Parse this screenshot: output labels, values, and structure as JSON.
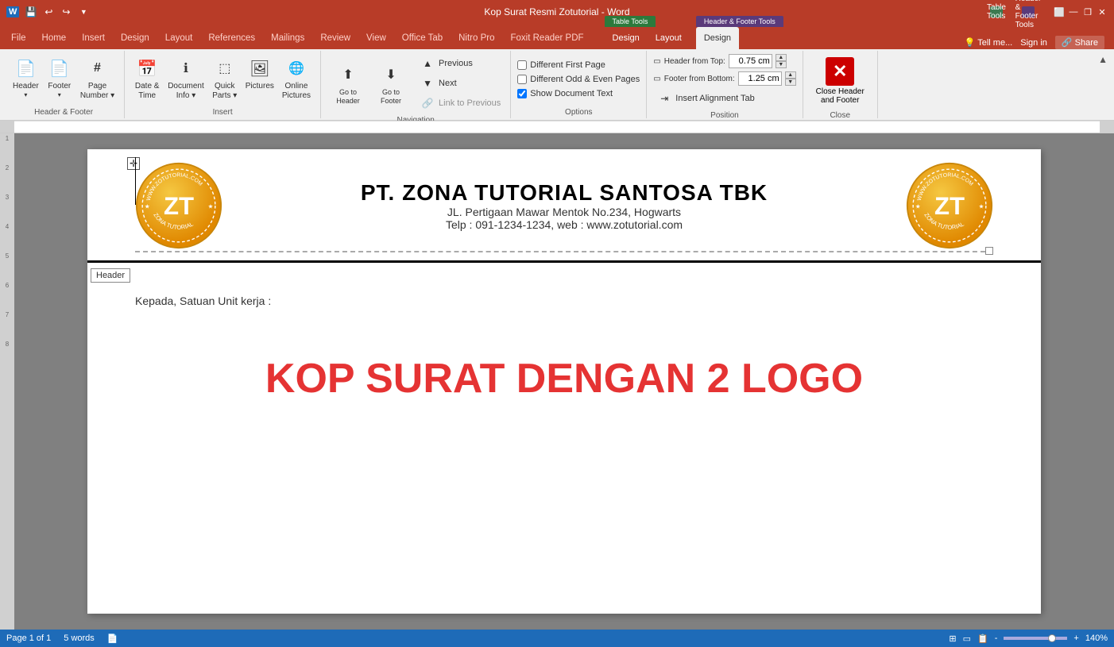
{
  "titlebar": {
    "title": "Kop Surat Resmi Zotutorial - Word",
    "controls": [
      "minimize",
      "restore",
      "close"
    ]
  },
  "quickaccess": {
    "buttons": [
      "save",
      "undo",
      "redo",
      "customize"
    ]
  },
  "ribbon_tabs": {
    "main": [
      "File",
      "Home",
      "Insert",
      "Design",
      "Layout",
      "References",
      "Mailings",
      "Review",
      "View",
      "Office Tab",
      "Nitro Pro",
      "Foxit Reader PDF"
    ],
    "context_groups": [
      {
        "label": "Table Tools",
        "tabs": [
          "Design",
          "Layout"
        ]
      },
      {
        "label": "Header & Footer Tools",
        "tabs": [
          "Design"
        ]
      }
    ],
    "active_tab": "Design",
    "right_buttons": [
      "Tell me...",
      "Sign in",
      "Share"
    ]
  },
  "ribbon": {
    "sections": [
      {
        "label": "Header & Footer",
        "items": [
          {
            "id": "header-btn",
            "icon": "📄",
            "label": "Header\n▾"
          },
          {
            "id": "footer-btn",
            "icon": "📄",
            "label": "Footer\n▾"
          },
          {
            "id": "page-number-btn",
            "icon": "#",
            "label": "Page\nNumber ▾"
          }
        ]
      },
      {
        "label": "Insert",
        "items": [
          {
            "id": "datetime-btn",
            "icon": "📅",
            "label": "Date &\nTime"
          },
          {
            "id": "docinfo-btn",
            "icon": "ℹ",
            "label": "Document\nInfo ▾"
          },
          {
            "id": "quickparts-btn",
            "icon": "⬚",
            "label": "Quick\nParts ▾"
          },
          {
            "id": "pictures-btn",
            "icon": "🖼",
            "label": "Pictures"
          },
          {
            "id": "onlinepics-btn",
            "icon": "🌐",
            "label": "Online\nPictures"
          }
        ]
      },
      {
        "label": "Navigation",
        "items": [
          {
            "id": "goto-header-btn",
            "icon": "⬆",
            "label": "Go to\nHeader"
          },
          {
            "id": "goto-footer-btn",
            "icon": "⬇",
            "label": "Go to\nFooter"
          },
          {
            "id": "previous-btn",
            "icon": "▲",
            "label": "Previous",
            "small": true
          },
          {
            "id": "next-btn",
            "icon": "▼",
            "label": "Next",
            "small": true
          },
          {
            "id": "linkto-btn",
            "icon": "🔗",
            "label": "Link to Previous",
            "small": true,
            "disabled": true
          }
        ]
      },
      {
        "label": "Options",
        "checkboxes": [
          {
            "id": "diff-first-page",
            "label": "Different First Page",
            "checked": false
          },
          {
            "id": "diff-odd-even",
            "label": "Different Odd & Even Pages",
            "checked": false
          },
          {
            "id": "show-doc-text",
            "label": "Show Document Text",
            "checked": true
          }
        ]
      },
      {
        "label": "Position",
        "rows": [
          {
            "id": "header-from-top",
            "label": "Header from Top:",
            "value": "0.75 cm"
          },
          {
            "id": "footer-from-bottom",
            "label": "Footer from Bottom:",
            "value": "1.25 cm"
          },
          {
            "id": "insert-align-tab",
            "label": "Insert Alignment Tab",
            "icon": "⇥"
          }
        ]
      },
      {
        "label": "Close",
        "items": [
          {
            "id": "close-hf-btn",
            "label": "Close Header\nand Footer"
          }
        ]
      }
    ]
  },
  "document": {
    "header": {
      "company_name": "PT. ZONA TUTORIAL SANTOSA TBK",
      "address": "JL. Pertigaan Mawar Mentok No.234, Hogwarts",
      "contact": "Telp : 091-1234-1234, web : www.zotutorial.com",
      "logo_text": "ZT",
      "logo_url": "WWW.ZOTUTORIAL.COM",
      "logo_subtext": "ZONA TUTORIAL"
    },
    "body": {
      "salutation": "Kepada, Satuan Unit kerja :",
      "watermark": "KOP SURAT DENGAN 2 LOGO"
    },
    "header_label": "Header"
  },
  "statusbar": {
    "page_info": "Page 1 of 1",
    "word_count": "5 words",
    "zoom": "140%",
    "zoom_min": "-",
    "zoom_plus": "+"
  }
}
